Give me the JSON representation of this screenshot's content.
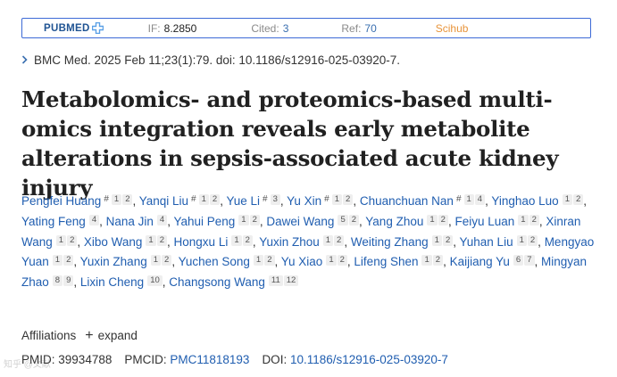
{
  "metrics": {
    "logo_text": "PUBMED",
    "if_label": "IF:",
    "if_value": "8.2850",
    "cited_label": "Cited:",
    "cited_value": "3",
    "ref_label": "Ref:",
    "ref_value": "70",
    "scihub": "Scihub",
    "colors": {
      "border": "#3d6ad6",
      "logo": "#205493",
      "link": "#3a6fb0",
      "scihub": "#e8943a"
    }
  },
  "citation": "BMC Med. 2025 Feb 11;23(1):79. doi: 10.1186/s12916-025-03920-7.",
  "title": "Metabolomics- and proteomics-based multi-omics integration reveals early metabolite alterations in sepsis-associated acute kidney injury",
  "authors": [
    {
      "name": "Pengfei Huang",
      "mark": "#",
      "affs": [
        "1",
        "2"
      ]
    },
    {
      "name": "Yanqi Liu",
      "mark": "#",
      "affs": [
        "1",
        "2"
      ]
    },
    {
      "name": "Yue Li",
      "mark": "#",
      "affs": [
        "3"
      ]
    },
    {
      "name": "Yu Xin",
      "mark": "#",
      "affs": [
        "1",
        "2"
      ]
    },
    {
      "name": "Chuanchuan Nan",
      "mark": "#",
      "affs": [
        "1",
        "4"
      ]
    },
    {
      "name": "Yinghao Luo",
      "mark": "",
      "affs": [
        "1",
        "2"
      ]
    },
    {
      "name": "Yating Feng",
      "mark": "",
      "affs": [
        "4"
      ]
    },
    {
      "name": "Nana Jin",
      "mark": "",
      "affs": [
        "4"
      ]
    },
    {
      "name": "Yahui Peng",
      "mark": "",
      "affs": [
        "1",
        "2"
      ]
    },
    {
      "name": "Dawei Wang",
      "mark": "",
      "affs": [
        "5",
        "2"
      ]
    },
    {
      "name": "Yang Zhou",
      "mark": "",
      "affs": [
        "1",
        "2"
      ]
    },
    {
      "name": "Feiyu Luan",
      "mark": "",
      "affs": [
        "1",
        "2"
      ]
    },
    {
      "name": "Xinran Wang",
      "mark": "",
      "affs": [
        "1",
        "2"
      ]
    },
    {
      "name": "Xibo Wang",
      "mark": "",
      "affs": [
        "1",
        "2"
      ]
    },
    {
      "name": "Hongxu Li",
      "mark": "",
      "affs": [
        "1",
        "2"
      ]
    },
    {
      "name": "Yuxin Zhou",
      "mark": "",
      "affs": [
        "1",
        "2"
      ]
    },
    {
      "name": "Weiting Zhang",
      "mark": "",
      "affs": [
        "1",
        "2"
      ]
    },
    {
      "name": "Yuhan Liu",
      "mark": "",
      "affs": [
        "1",
        "2"
      ]
    },
    {
      "name": "Mengyao Yuan",
      "mark": "",
      "affs": [
        "1",
        "2"
      ]
    },
    {
      "name": "Yuxin Zhang",
      "mark": "",
      "affs": [
        "1",
        "2"
      ]
    },
    {
      "name": "Yuchen Song",
      "mark": "",
      "affs": [
        "1",
        "2"
      ]
    },
    {
      "name": "Yu Xiao",
      "mark": "",
      "affs": [
        "1",
        "2"
      ]
    },
    {
      "name": "Lifeng Shen",
      "mark": "",
      "affs": [
        "1",
        "2"
      ]
    },
    {
      "name": "Kaijiang Yu",
      "mark": "",
      "affs": [
        "6",
        "7"
      ]
    },
    {
      "name": "Mingyan Zhao",
      "mark": "",
      "affs": [
        "8",
        "9"
      ]
    },
    {
      "name": "Lixin Cheng",
      "mark": "",
      "affs": [
        "10"
      ]
    },
    {
      "name": "Changsong Wang",
      "mark": "",
      "affs": [
        "11",
        "12"
      ]
    }
  ],
  "affiliations": {
    "label": "Affiliations",
    "expand": "expand"
  },
  "ids": {
    "pmid_label": "PMID:",
    "pmid": "39934788",
    "pmcid_label": "PMCID:",
    "pmcid": "PMC11818193",
    "doi_label": "DOI:",
    "doi": "10.1186/s12916-025-03920-7"
  },
  "watermark": "知乎 @文献"
}
